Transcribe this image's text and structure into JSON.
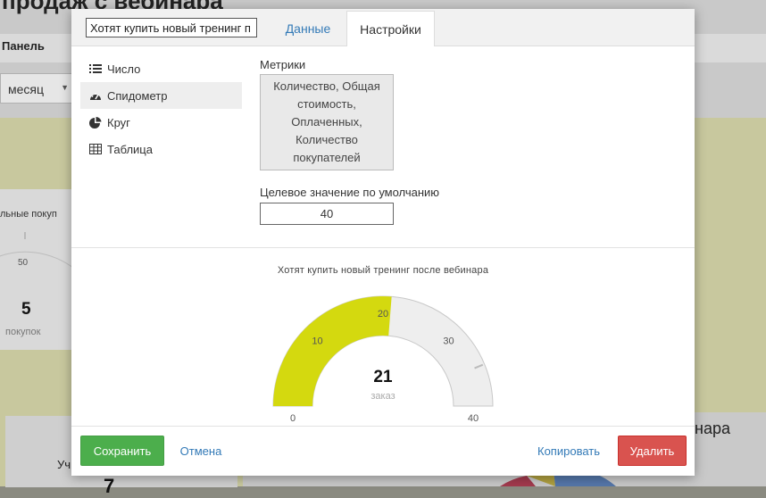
{
  "background": {
    "page_title": "продаж с вебинара",
    "panel_label": "Панель",
    "period_select": "месяц",
    "card_title": "льные покуп",
    "gauge_tick": "50",
    "gauge_value": "5",
    "gauge_unit": "покупок",
    "card2_label": "Уч",
    "card2_value": "7",
    "right_title": "нара"
  },
  "modal": {
    "name_value": "Хотят купить новый тренинг п",
    "tabs": [
      {
        "label": "Данные"
      },
      {
        "label": "Настройки"
      }
    ],
    "active_tab": "Настройки",
    "widget_types": [
      {
        "label": "Число",
        "icon": "list-icon"
      },
      {
        "label": "Спидометр",
        "icon": "dashboard-icon"
      },
      {
        "label": "Круг",
        "icon": "pie-chart-icon"
      },
      {
        "label": "Таблица",
        "icon": "table-icon"
      }
    ],
    "selected_type": "Спидометр",
    "metrics_label": "Метрики",
    "metrics_lines": [
      "Количество, Общая",
      "стоимость,",
      "Оплаченных,",
      "Количество",
      "покупателей"
    ],
    "target_label": "Целевое значение по умолчанию",
    "target_value": "40"
  },
  "gauge": {
    "title": "Хотят купить новый тренинг после вебинара",
    "value": 21,
    "value_label": "21",
    "unit": "заказ",
    "min": 0,
    "max": 40,
    "ticks": [
      "0",
      "10",
      "20",
      "30",
      "40"
    ],
    "target": 40,
    "fill_color": "#d4d90f",
    "track_color": "#eeeeee"
  },
  "footer": {
    "save_label": "Сохранить",
    "cancel_label": "Отмена",
    "copy_label": "Копировать",
    "delete_label": "Удалить"
  }
}
